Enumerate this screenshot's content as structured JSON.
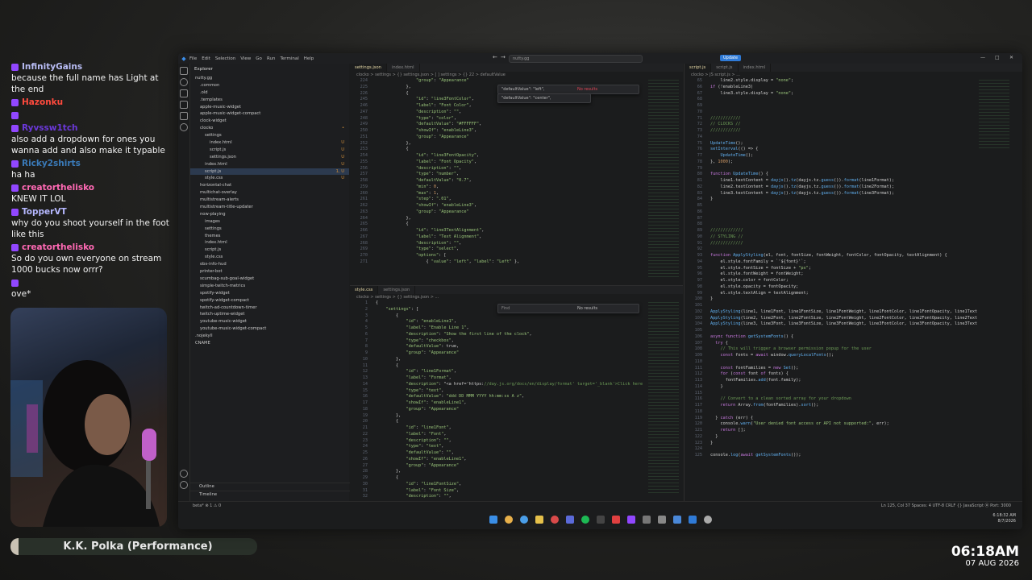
{
  "chat": [
    {
      "user": "InfinityGains",
      "color": "#b9bdf5",
      "text": "because the full name has Light at the end"
    },
    {
      "user": "Hazonku",
      "color": "#ff4a3d",
      "text": ""
    },
    {
      "user": "",
      "color": "#ffffff",
      "text": ""
    },
    {
      "user": "Ryvssw1tch",
      "color": "#6b38d9",
      "text": "also add a dropdown for ones you wanna add and also make it typable"
    },
    {
      "user": "Ricky2shirts",
      "color": "#3a7ab8",
      "text": "ha ha"
    },
    {
      "user": "creatorthelisko",
      "color": "#ff69b4",
      "text": "KNEW IT LOL"
    },
    {
      "user": "TopperVT",
      "color": "#b6b8ff",
      "text": "why do you shoot yourself in the foot like this"
    },
    {
      "user": "creatorthelisko",
      "color": "#ff69b4",
      "text": "So do you own everyone on stream 1000 bucks now orrr?"
    },
    {
      "user": "",
      "color": "#ffffff",
      "text": "ove*"
    }
  ],
  "now_playing": "K.K. Polka (Performance)",
  "overlay_clock": {
    "time": "06:18AM",
    "date": "07 AUG 2026"
  },
  "vscode": {
    "menu": [
      "File",
      "Edit",
      "Selection",
      "View",
      "Go",
      "Run",
      "Terminal",
      "Help"
    ],
    "search": "nutty.gg",
    "update_label": "Update",
    "explorer_title": "Explorer",
    "tree": [
      {
        "label": "nutty.gg",
        "indent": 0,
        "sel": false,
        "mod": ""
      },
      {
        "label": ".common",
        "indent": 1,
        "sel": false,
        "mod": ""
      },
      {
        "label": ".old",
        "indent": 1,
        "sel": false,
        "mod": ""
      },
      {
        "label": ".templates",
        "indent": 1,
        "sel": false,
        "mod": ""
      },
      {
        "label": "apple-music-widget",
        "indent": 1,
        "sel": false,
        "mod": ""
      },
      {
        "label": "apple-music-widget-compact",
        "indent": 1,
        "sel": false,
        "mod": ""
      },
      {
        "label": "clock-widget",
        "indent": 1,
        "sel": false,
        "mod": ""
      },
      {
        "label": "clocko",
        "indent": 1,
        "sel": false,
        "mod": "•"
      },
      {
        "label": "settings",
        "indent": 2,
        "sel": false,
        "mod": ""
      },
      {
        "label": "index.html",
        "indent": 3,
        "sel": false,
        "mod": "U"
      },
      {
        "label": "script.js",
        "indent": 3,
        "sel": false,
        "mod": "U"
      },
      {
        "label": "settings.json",
        "indent": 3,
        "sel": false,
        "mod": "U"
      },
      {
        "label": "index.html",
        "indent": 2,
        "sel": false,
        "mod": "U"
      },
      {
        "label": "script.js",
        "indent": 2,
        "sel": true,
        "mod": "1, U"
      },
      {
        "label": "style.css",
        "indent": 2,
        "sel": false,
        "mod": "U"
      },
      {
        "label": "horizontal-chat",
        "indent": 1,
        "sel": false,
        "mod": ""
      },
      {
        "label": "multichat-overlay",
        "indent": 1,
        "sel": false,
        "mod": ""
      },
      {
        "label": "multistream-alerts",
        "indent": 1,
        "sel": false,
        "mod": ""
      },
      {
        "label": "multistream-title-updater",
        "indent": 1,
        "sel": false,
        "mod": ""
      },
      {
        "label": "now-playing",
        "indent": 1,
        "sel": false,
        "mod": ""
      },
      {
        "label": "images",
        "indent": 2,
        "sel": false,
        "mod": ""
      },
      {
        "label": "settings",
        "indent": 2,
        "sel": false,
        "mod": ""
      },
      {
        "label": "themes",
        "indent": 2,
        "sel": false,
        "mod": ""
      },
      {
        "label": "index.html",
        "indent": 2,
        "sel": false,
        "mod": ""
      },
      {
        "label": "script.js",
        "indent": 2,
        "sel": false,
        "mod": ""
      },
      {
        "label": "style.css",
        "indent": 2,
        "sel": false,
        "mod": ""
      },
      {
        "label": "obs-info-hud",
        "indent": 1,
        "sel": false,
        "mod": ""
      },
      {
        "label": "printer-bot",
        "indent": 1,
        "sel": false,
        "mod": ""
      },
      {
        "label": "scumbag-sub-goal-widget",
        "indent": 1,
        "sel": false,
        "mod": ""
      },
      {
        "label": "simple-twitch-metrics",
        "indent": 1,
        "sel": false,
        "mod": ""
      },
      {
        "label": "spotify-widget",
        "indent": 1,
        "sel": false,
        "mod": ""
      },
      {
        "label": "spotify-widget-compact",
        "indent": 1,
        "sel": false,
        "mod": ""
      },
      {
        "label": "twitch-ad-countdown-timer",
        "indent": 1,
        "sel": false,
        "mod": ""
      },
      {
        "label": "twitch-uptime-widget",
        "indent": 1,
        "sel": false,
        "mod": ""
      },
      {
        "label": "youtube-music-widget",
        "indent": 1,
        "sel": false,
        "mod": ""
      },
      {
        "label": "youtube-music-widget-compact",
        "indent": 1,
        "sel": false,
        "mod": ""
      },
      {
        "label": ".nojekyll",
        "indent": 0,
        "sel": false,
        "mod": ""
      },
      {
        "label": "CNAME",
        "indent": 0,
        "sel": false,
        "mod": ""
      }
    ],
    "outline_label": "Outline",
    "timeline_label": "Timeline",
    "top_tabs": [
      "settings.json",
      "index.html"
    ],
    "top_crumb": "clocko > settings > {} settings.json > [ ] settings > {} 22 > defaultValue",
    "find_top": {
      "a": "\"defaultValue\": \"left\",",
      "b": "\"defaultValue\": \"center\",",
      "results": "No results"
    },
    "top_code": [
      {
        "n": "224",
        "t": "                \"group\": \"Appearance\""
      },
      {
        "n": "225",
        "t": "            },"
      },
      {
        "n": "226",
        "t": "            {"
      },
      {
        "n": "245",
        "t": "                \"id\": \"line3FontColor\","
      },
      {
        "n": "246",
        "t": "                \"label\": \"Font Color\","
      },
      {
        "n": "247",
        "t": "                \"description\": \"\","
      },
      {
        "n": "248",
        "t": "                \"type\": \"color\","
      },
      {
        "n": "249",
        "t": "                \"defaultValue\": \"#FFFFFF\","
      },
      {
        "n": "250",
        "t": "                \"showIf\": \"enableLine3\","
      },
      {
        "n": "251",
        "t": "                \"group\": \"Appearance\""
      },
      {
        "n": "252",
        "t": "            },"
      },
      {
        "n": "253",
        "t": "            {"
      },
      {
        "n": "254",
        "t": "                \"id\": \"line3FontOpacity\","
      },
      {
        "n": "255",
        "t": "                \"label\": \"Font Opacity\","
      },
      {
        "n": "256",
        "t": "                \"description\": \"\","
      },
      {
        "n": "257",
        "t": "                \"type\": \"number\","
      },
      {
        "n": "258",
        "t": "                \"defaultValue\": \"0.7\","
      },
      {
        "n": "259",
        "t": "                \"min\": 0,"
      },
      {
        "n": "260",
        "t": "                \"max\": 1,"
      },
      {
        "n": "261",
        "t": "                \"step\": \".01\","
      },
      {
        "n": "262",
        "t": "                \"showIf\": \"enableLine3\","
      },
      {
        "n": "263",
        "t": "                \"group\": \"Appearance\""
      },
      {
        "n": "264",
        "t": "            },"
      },
      {
        "n": "265",
        "t": "            {"
      },
      {
        "n": "266",
        "t": "                \"id\": \"line3TextAlignment\","
      },
      {
        "n": "267",
        "t": "                \"label\": \"Text Alignment\","
      },
      {
        "n": "268",
        "t": "                \"description\": \"\","
      },
      {
        "n": "269",
        "t": "                \"type\": \"select\","
      },
      {
        "n": "270",
        "t": "                \"options\": ["
      },
      {
        "n": "271",
        "t": "                    { \"value\": \"left\", \"label\": \"Left\" },"
      }
    ],
    "bottom_tabs": [
      "style.css",
      "settings.json"
    ],
    "bottom_crumb": "clocko > settings > {} settings.json > ...",
    "find_bottom": {
      "a": "Find",
      "results": "No results"
    },
    "bottom_code": [
      {
        "n": "1",
        "t": "{"
      },
      {
        "n": "2",
        "t": "    \"settings\": ["
      },
      {
        "n": "3",
        "t": "        {"
      },
      {
        "n": "4",
        "t": "            \"id\": \"enableLine1\","
      },
      {
        "n": "5",
        "t": "            \"label\": \"Enable Line 1\","
      },
      {
        "n": "6",
        "t": "            \"description\": \"Show the first line of the clock\","
      },
      {
        "n": "7",
        "t": "            \"type\": \"checkbox\","
      },
      {
        "n": "8",
        "t": "            \"defaultValue\": true,"
      },
      {
        "n": "9",
        "t": "            \"group\": \"Appearance\""
      },
      {
        "n": "10",
        "t": "        },"
      },
      {
        "n": "11",
        "t": "        {"
      },
      {
        "n": "12",
        "t": "            \"id\": \"line1Format\","
      },
      {
        "n": "13",
        "t": "            \"label\": \"Format\","
      },
      {
        "n": "14",
        "t": "            \"description\": \"<a href='https://day.js.org/docs/en/display/format' target='_blank'>Click here"
      },
      {
        "n": "15",
        "t": "            \"type\": \"text\","
      },
      {
        "n": "16",
        "t": "            \"defaultValue\": \"ddd DD MMM YYYY hh:mm:ss A z\","
      },
      {
        "n": "17",
        "t": "            \"showIf\": \"enableLine1\","
      },
      {
        "n": "18",
        "t": "            \"group\": \"Appearance\""
      },
      {
        "n": "19",
        "t": "        },"
      },
      {
        "n": "20",
        "t": "        {"
      },
      {
        "n": "21",
        "t": "            \"id\": \"line1Font\","
      },
      {
        "n": "22",
        "t": "            \"label\": \"Font\","
      },
      {
        "n": "23",
        "t": "            \"description\": \"\","
      },
      {
        "n": "24",
        "t": "            \"type\": \"text\","
      },
      {
        "n": "25",
        "t": "            \"defaultValue\": \"\","
      },
      {
        "n": "26",
        "t": "            \"showIf\": \"enableLine1\","
      },
      {
        "n": "27",
        "t": "            \"group\": \"Appearance\""
      },
      {
        "n": "28",
        "t": "        },"
      },
      {
        "n": "29",
        "t": "        {"
      },
      {
        "n": "30",
        "t": "            \"id\": \"line1FontSize\","
      },
      {
        "n": "31",
        "t": "            \"label\": \"Font Size\","
      },
      {
        "n": "32",
        "t": "            \"description\": \"\","
      }
    ],
    "right_tabs": [
      "script.js",
      "script.js",
      "index.html"
    ],
    "right_crumb": "clocko > JS script.js > ...",
    "right_code": [
      {
        "n": "65",
        "t": "    line2.style.display = \"none\";"
      },
      {
        "n": "66",
        "t": "if (!enableLine3)"
      },
      {
        "n": "67",
        "t": "    line3.style.display = \"none\";"
      },
      {
        "n": "68",
        "t": ""
      },
      {
        "n": "69",
        "t": ""
      },
      {
        "n": "70",
        "t": ""
      },
      {
        "n": "71",
        "t": "////////////"
      },
      {
        "n": "72",
        "t": "// CLOCKS //"
      },
      {
        "n": "73",
        "t": "////////////"
      },
      {
        "n": "74",
        "t": ""
      },
      {
        "n": "75",
        "t": "UpdateTime();"
      },
      {
        "n": "76",
        "t": "setInterval(() => {"
      },
      {
        "n": "77",
        "t": "    UpdateTime();"
      },
      {
        "n": "78",
        "t": "}, 1000);"
      },
      {
        "n": "79",
        "t": ""
      },
      {
        "n": "80",
        "t": "function UpdateTime() {"
      },
      {
        "n": "81",
        "t": "    line1.textContent = dayjs().tz(dayjs.tz.guess()).format(line1Format);"
      },
      {
        "n": "82",
        "t": "    line2.textContent = dayjs().tz(dayjs.tz.guess()).format(line2Format);"
      },
      {
        "n": "83",
        "t": "    line3.textContent = dayjs().tz(dayjs.tz.guess()).format(line3Format);"
      },
      {
        "n": "84",
        "t": "}"
      },
      {
        "n": "85",
        "t": ""
      },
      {
        "n": "86",
        "t": ""
      },
      {
        "n": "87",
        "t": ""
      },
      {
        "n": "88",
        "t": ""
      },
      {
        "n": "89",
        "t": "/////////////"
      },
      {
        "n": "90",
        "t": "// STYLING //"
      },
      {
        "n": "91",
        "t": "/////////////"
      },
      {
        "n": "92",
        "t": ""
      },
      {
        "n": "93",
        "t": "function ApplyStyling(el, font, fontSize, fontWeight, fontColor, fontOpacity, textAlignment) {"
      },
      {
        "n": "94",
        "t": "    el.style.fontFamily = `'${font}'`;"
      },
      {
        "n": "95",
        "t": "    el.style.fontSize = fontSize + \"px\";"
      },
      {
        "n": "96",
        "t": "    el.style.fontWeight = fontWeight;"
      },
      {
        "n": "97",
        "t": "    el.style.color = fontColor;"
      },
      {
        "n": "98",
        "t": "    el.style.opacity = fontOpacity;"
      },
      {
        "n": "99",
        "t": "    el.style.textAlign = textAlignment;"
      },
      {
        "n": "100",
        "t": "}"
      },
      {
        "n": "101",
        "t": ""
      },
      {
        "n": "102",
        "t": "ApplyStyling(line1, line1Font, line1FontSize, line1FontWeight, line1FontColor, line1FontOpacity, line1Text"
      },
      {
        "n": "103",
        "t": "ApplyStyling(line2, line2Font, line2FontSize, line2FontWeight, line2FontColor, line2FontOpacity, line2Text"
      },
      {
        "n": "104",
        "t": "ApplyStyling(line3, line3Font, line3FontSize, line3FontWeight, line3FontColor, line3FontOpacity, line3Text"
      },
      {
        "n": "105",
        "t": ""
      },
      {
        "n": "106",
        "t": "async function getSystemFonts() {"
      },
      {
        "n": "107",
        "t": "  try {"
      },
      {
        "n": "108",
        "t": "    // This will trigger a browser permission popup for the user"
      },
      {
        "n": "109",
        "t": "    const fonts = await window.queryLocalFonts();"
      },
      {
        "n": "110",
        "t": ""
      },
      {
        "n": "111",
        "t": "    const fontFamilies = new Set();"
      },
      {
        "n": "112",
        "t": "    for (const font of fonts) {"
      },
      {
        "n": "113",
        "t": "      fontFamilies.add(font.family);"
      },
      {
        "n": "114",
        "t": "    }"
      },
      {
        "n": "115",
        "t": ""
      },
      {
        "n": "116",
        "t": "    // Convert to a clean sorted array for your dropdown"
      },
      {
        "n": "117",
        "t": "    return Array.from(fontFamilies).sort();"
      },
      {
        "n": "118",
        "t": ""
      },
      {
        "n": "119",
        "t": "  } catch (err) {"
      },
      {
        "n": "120",
        "t": "    console.warn(\"User denied font access or API not supported:\", err);"
      },
      {
        "n": "121",
        "t": "    return [];"
      },
      {
        "n": "122",
        "t": "  }"
      },
      {
        "n": "123",
        "t": "}"
      },
      {
        "n": "124",
        "t": ""
      },
      {
        "n": "125",
        "t": "console.log(await getSystemFonts());"
      }
    ],
    "status_left": "beta*  ⊗ 1 ⚠ 0",
    "status_right": "Ln 125, Col 37   Spaces: 4   UTF-8   CRLF   {} JavaScript   ⦿ Port: 3000",
    "tray_time": "6:18:32 AM",
    "tray_date": "8/7/2026"
  }
}
